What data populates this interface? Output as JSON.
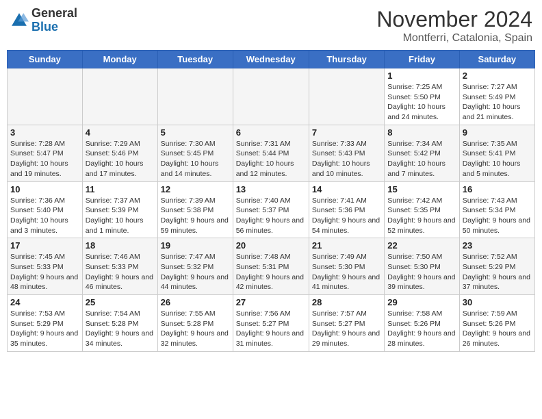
{
  "header": {
    "logo_general": "General",
    "logo_blue": "Blue",
    "month_title": "November 2024",
    "location": "Montferri, Catalonia, Spain"
  },
  "days_of_week": [
    "Sunday",
    "Monday",
    "Tuesday",
    "Wednesday",
    "Thursday",
    "Friday",
    "Saturday"
  ],
  "weeks": [
    {
      "days": [
        {
          "num": "",
          "info": ""
        },
        {
          "num": "",
          "info": ""
        },
        {
          "num": "",
          "info": ""
        },
        {
          "num": "",
          "info": ""
        },
        {
          "num": "",
          "info": ""
        },
        {
          "num": "1",
          "info": "Sunrise: 7:25 AM\nSunset: 5:50 PM\nDaylight: 10 hours and 24 minutes."
        },
        {
          "num": "2",
          "info": "Sunrise: 7:27 AM\nSunset: 5:49 PM\nDaylight: 10 hours and 21 minutes."
        }
      ]
    },
    {
      "days": [
        {
          "num": "3",
          "info": "Sunrise: 7:28 AM\nSunset: 5:47 PM\nDaylight: 10 hours and 19 minutes."
        },
        {
          "num": "4",
          "info": "Sunrise: 7:29 AM\nSunset: 5:46 PM\nDaylight: 10 hours and 17 minutes."
        },
        {
          "num": "5",
          "info": "Sunrise: 7:30 AM\nSunset: 5:45 PM\nDaylight: 10 hours and 14 minutes."
        },
        {
          "num": "6",
          "info": "Sunrise: 7:31 AM\nSunset: 5:44 PM\nDaylight: 10 hours and 12 minutes."
        },
        {
          "num": "7",
          "info": "Sunrise: 7:33 AM\nSunset: 5:43 PM\nDaylight: 10 hours and 10 minutes."
        },
        {
          "num": "8",
          "info": "Sunrise: 7:34 AM\nSunset: 5:42 PM\nDaylight: 10 hours and 7 minutes."
        },
        {
          "num": "9",
          "info": "Sunrise: 7:35 AM\nSunset: 5:41 PM\nDaylight: 10 hours and 5 minutes."
        }
      ]
    },
    {
      "days": [
        {
          "num": "10",
          "info": "Sunrise: 7:36 AM\nSunset: 5:40 PM\nDaylight: 10 hours and 3 minutes."
        },
        {
          "num": "11",
          "info": "Sunrise: 7:37 AM\nSunset: 5:39 PM\nDaylight: 10 hours and 1 minute."
        },
        {
          "num": "12",
          "info": "Sunrise: 7:39 AM\nSunset: 5:38 PM\nDaylight: 9 hours and 59 minutes."
        },
        {
          "num": "13",
          "info": "Sunrise: 7:40 AM\nSunset: 5:37 PM\nDaylight: 9 hours and 56 minutes."
        },
        {
          "num": "14",
          "info": "Sunrise: 7:41 AM\nSunset: 5:36 PM\nDaylight: 9 hours and 54 minutes."
        },
        {
          "num": "15",
          "info": "Sunrise: 7:42 AM\nSunset: 5:35 PM\nDaylight: 9 hours and 52 minutes."
        },
        {
          "num": "16",
          "info": "Sunrise: 7:43 AM\nSunset: 5:34 PM\nDaylight: 9 hours and 50 minutes."
        }
      ]
    },
    {
      "days": [
        {
          "num": "17",
          "info": "Sunrise: 7:45 AM\nSunset: 5:33 PM\nDaylight: 9 hours and 48 minutes."
        },
        {
          "num": "18",
          "info": "Sunrise: 7:46 AM\nSunset: 5:33 PM\nDaylight: 9 hours and 46 minutes."
        },
        {
          "num": "19",
          "info": "Sunrise: 7:47 AM\nSunset: 5:32 PM\nDaylight: 9 hours and 44 minutes."
        },
        {
          "num": "20",
          "info": "Sunrise: 7:48 AM\nSunset: 5:31 PM\nDaylight: 9 hours and 42 minutes."
        },
        {
          "num": "21",
          "info": "Sunrise: 7:49 AM\nSunset: 5:30 PM\nDaylight: 9 hours and 41 minutes."
        },
        {
          "num": "22",
          "info": "Sunrise: 7:50 AM\nSunset: 5:30 PM\nDaylight: 9 hours and 39 minutes."
        },
        {
          "num": "23",
          "info": "Sunrise: 7:52 AM\nSunset: 5:29 PM\nDaylight: 9 hours and 37 minutes."
        }
      ]
    },
    {
      "days": [
        {
          "num": "24",
          "info": "Sunrise: 7:53 AM\nSunset: 5:29 PM\nDaylight: 9 hours and 35 minutes."
        },
        {
          "num": "25",
          "info": "Sunrise: 7:54 AM\nSunset: 5:28 PM\nDaylight: 9 hours and 34 minutes."
        },
        {
          "num": "26",
          "info": "Sunrise: 7:55 AM\nSunset: 5:28 PM\nDaylight: 9 hours and 32 minutes."
        },
        {
          "num": "27",
          "info": "Sunrise: 7:56 AM\nSunset: 5:27 PM\nDaylight: 9 hours and 31 minutes."
        },
        {
          "num": "28",
          "info": "Sunrise: 7:57 AM\nSunset: 5:27 PM\nDaylight: 9 hours and 29 minutes."
        },
        {
          "num": "29",
          "info": "Sunrise: 7:58 AM\nSunset: 5:26 PM\nDaylight: 9 hours and 28 minutes."
        },
        {
          "num": "30",
          "info": "Sunrise: 7:59 AM\nSunset: 5:26 PM\nDaylight: 9 hours and 26 minutes."
        }
      ]
    }
  ]
}
